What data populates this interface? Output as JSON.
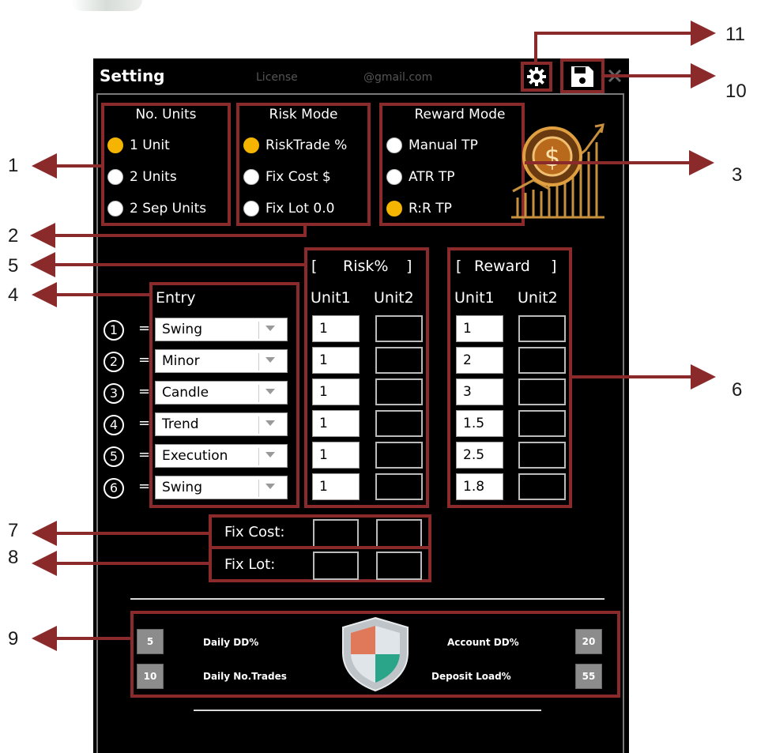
{
  "window": {
    "title": "Setting",
    "license_label": "License",
    "email": "@gmail.com"
  },
  "callouts": [
    "1",
    "2",
    "3",
    "4",
    "5",
    "6",
    "7",
    "8",
    "9",
    "10",
    "11"
  ],
  "units_group": {
    "title": "No. Units",
    "options": [
      "1 Unit",
      "2 Units",
      "2 Sep Units"
    ],
    "selected": 0
  },
  "risk_group": {
    "title": "Risk Mode",
    "options": [
      "RiskTrade %",
      "Fix Cost $",
      "Fix Lot 0.0"
    ],
    "selected": 0
  },
  "reward_group": {
    "title": "Reward Mode",
    "options": [
      "Manual TP",
      "ATR TP",
      "R:R TP"
    ],
    "selected": 2
  },
  "entry": {
    "title": "Entry",
    "eq": "=",
    "rows": [
      {
        "num": "1",
        "value": "Swing"
      },
      {
        "num": "2",
        "value": "Minor"
      },
      {
        "num": "3",
        "value": "Candle"
      },
      {
        "num": "4",
        "value": "Trend"
      },
      {
        "num": "5",
        "value": "Execution"
      },
      {
        "num": "6",
        "value": "Swing"
      }
    ]
  },
  "risk": {
    "title_open": "[",
    "title": "Risk%",
    "title_close": "]",
    "col1": "Unit1",
    "col2": "Unit2",
    "unit1": [
      "1",
      "1",
      "1",
      "1",
      "1",
      "1"
    ]
  },
  "reward": {
    "title_open": "[",
    "title": "Reward",
    "title_close": "]",
    "col1": "Unit1",
    "col2": "Unit2",
    "unit1": [
      "1",
      "2",
      "3",
      "1.5",
      "2.5",
      "1.8"
    ]
  },
  "fix": {
    "cost_label": "Fix Cost:",
    "lot_label": "Fix Lot:"
  },
  "protection": {
    "daily_dd_label": "Daily DD%",
    "daily_dd_value": "5",
    "daily_trades_label": "Daily No.Trades",
    "daily_trades_value": "10",
    "account_dd_label": "Account DD%",
    "account_dd_value": "20",
    "deposit_load_label": "Deposit Load%",
    "deposit_load_value": "55"
  },
  "icons": [
    "gear-icon",
    "save-icon",
    "close-icon",
    "dollar-coin-chart-icon",
    "shield-icon"
  ],
  "colors": {
    "callout_box": "#8a2a2a",
    "radio_selected": "#f4b400",
    "background": "#000000"
  }
}
